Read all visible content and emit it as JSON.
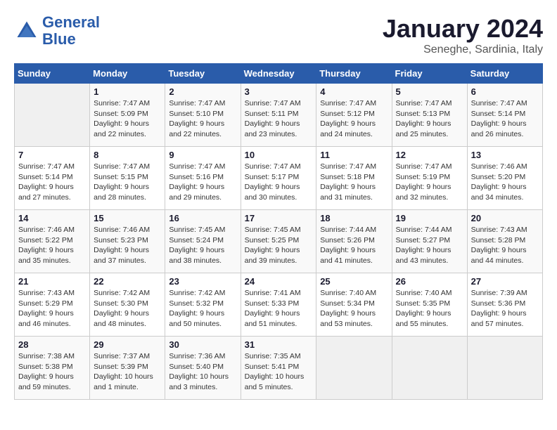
{
  "header": {
    "logo_line1": "General",
    "logo_line2": "Blue",
    "month_year": "January 2024",
    "location": "Seneghe, Sardinia, Italy"
  },
  "weekdays": [
    "Sunday",
    "Monday",
    "Tuesday",
    "Wednesday",
    "Thursday",
    "Friday",
    "Saturday"
  ],
  "weeks": [
    [
      {
        "day": "",
        "sunrise": "",
        "sunset": "",
        "daylight": ""
      },
      {
        "day": "1",
        "sunrise": "Sunrise: 7:47 AM",
        "sunset": "Sunset: 5:09 PM",
        "daylight": "Daylight: 9 hours and 22 minutes."
      },
      {
        "day": "2",
        "sunrise": "Sunrise: 7:47 AM",
        "sunset": "Sunset: 5:10 PM",
        "daylight": "Daylight: 9 hours and 22 minutes."
      },
      {
        "day": "3",
        "sunrise": "Sunrise: 7:47 AM",
        "sunset": "Sunset: 5:11 PM",
        "daylight": "Daylight: 9 hours and 23 minutes."
      },
      {
        "day": "4",
        "sunrise": "Sunrise: 7:47 AM",
        "sunset": "Sunset: 5:12 PM",
        "daylight": "Daylight: 9 hours and 24 minutes."
      },
      {
        "day": "5",
        "sunrise": "Sunrise: 7:47 AM",
        "sunset": "Sunset: 5:13 PM",
        "daylight": "Daylight: 9 hours and 25 minutes."
      },
      {
        "day": "6",
        "sunrise": "Sunrise: 7:47 AM",
        "sunset": "Sunset: 5:14 PM",
        "daylight": "Daylight: 9 hours and 26 minutes."
      }
    ],
    [
      {
        "day": "7",
        "sunrise": "Sunrise: 7:47 AM",
        "sunset": "Sunset: 5:14 PM",
        "daylight": "Daylight: 9 hours and 27 minutes."
      },
      {
        "day": "8",
        "sunrise": "Sunrise: 7:47 AM",
        "sunset": "Sunset: 5:15 PM",
        "daylight": "Daylight: 9 hours and 28 minutes."
      },
      {
        "day": "9",
        "sunrise": "Sunrise: 7:47 AM",
        "sunset": "Sunset: 5:16 PM",
        "daylight": "Daylight: 9 hours and 29 minutes."
      },
      {
        "day": "10",
        "sunrise": "Sunrise: 7:47 AM",
        "sunset": "Sunset: 5:17 PM",
        "daylight": "Daylight: 9 hours and 30 minutes."
      },
      {
        "day": "11",
        "sunrise": "Sunrise: 7:47 AM",
        "sunset": "Sunset: 5:18 PM",
        "daylight": "Daylight: 9 hours and 31 minutes."
      },
      {
        "day": "12",
        "sunrise": "Sunrise: 7:47 AM",
        "sunset": "Sunset: 5:19 PM",
        "daylight": "Daylight: 9 hours and 32 minutes."
      },
      {
        "day": "13",
        "sunrise": "Sunrise: 7:46 AM",
        "sunset": "Sunset: 5:20 PM",
        "daylight": "Daylight: 9 hours and 34 minutes."
      }
    ],
    [
      {
        "day": "14",
        "sunrise": "Sunrise: 7:46 AM",
        "sunset": "Sunset: 5:22 PM",
        "daylight": "Daylight: 9 hours and 35 minutes."
      },
      {
        "day": "15",
        "sunrise": "Sunrise: 7:46 AM",
        "sunset": "Sunset: 5:23 PM",
        "daylight": "Daylight: 9 hours and 37 minutes."
      },
      {
        "day": "16",
        "sunrise": "Sunrise: 7:45 AM",
        "sunset": "Sunset: 5:24 PM",
        "daylight": "Daylight: 9 hours and 38 minutes."
      },
      {
        "day": "17",
        "sunrise": "Sunrise: 7:45 AM",
        "sunset": "Sunset: 5:25 PM",
        "daylight": "Daylight: 9 hours and 39 minutes."
      },
      {
        "day": "18",
        "sunrise": "Sunrise: 7:44 AM",
        "sunset": "Sunset: 5:26 PM",
        "daylight": "Daylight: 9 hours and 41 minutes."
      },
      {
        "day": "19",
        "sunrise": "Sunrise: 7:44 AM",
        "sunset": "Sunset: 5:27 PM",
        "daylight": "Daylight: 9 hours and 43 minutes."
      },
      {
        "day": "20",
        "sunrise": "Sunrise: 7:43 AM",
        "sunset": "Sunset: 5:28 PM",
        "daylight": "Daylight: 9 hours and 44 minutes."
      }
    ],
    [
      {
        "day": "21",
        "sunrise": "Sunrise: 7:43 AM",
        "sunset": "Sunset: 5:29 PM",
        "daylight": "Daylight: 9 hours and 46 minutes."
      },
      {
        "day": "22",
        "sunrise": "Sunrise: 7:42 AM",
        "sunset": "Sunset: 5:30 PM",
        "daylight": "Daylight: 9 hours and 48 minutes."
      },
      {
        "day": "23",
        "sunrise": "Sunrise: 7:42 AM",
        "sunset": "Sunset: 5:32 PM",
        "daylight": "Daylight: 9 hours and 50 minutes."
      },
      {
        "day": "24",
        "sunrise": "Sunrise: 7:41 AM",
        "sunset": "Sunset: 5:33 PM",
        "daylight": "Daylight: 9 hours and 51 minutes."
      },
      {
        "day": "25",
        "sunrise": "Sunrise: 7:40 AM",
        "sunset": "Sunset: 5:34 PM",
        "daylight": "Daylight: 9 hours and 53 minutes."
      },
      {
        "day": "26",
        "sunrise": "Sunrise: 7:40 AM",
        "sunset": "Sunset: 5:35 PM",
        "daylight": "Daylight: 9 hours and 55 minutes."
      },
      {
        "day": "27",
        "sunrise": "Sunrise: 7:39 AM",
        "sunset": "Sunset: 5:36 PM",
        "daylight": "Daylight: 9 hours and 57 minutes."
      }
    ],
    [
      {
        "day": "28",
        "sunrise": "Sunrise: 7:38 AM",
        "sunset": "Sunset: 5:38 PM",
        "daylight": "Daylight: 9 hours and 59 minutes."
      },
      {
        "day": "29",
        "sunrise": "Sunrise: 7:37 AM",
        "sunset": "Sunset: 5:39 PM",
        "daylight": "Daylight: 10 hours and 1 minute."
      },
      {
        "day": "30",
        "sunrise": "Sunrise: 7:36 AM",
        "sunset": "Sunset: 5:40 PM",
        "daylight": "Daylight: 10 hours and 3 minutes."
      },
      {
        "day": "31",
        "sunrise": "Sunrise: 7:35 AM",
        "sunset": "Sunset: 5:41 PM",
        "daylight": "Daylight: 10 hours and 5 minutes."
      },
      {
        "day": "",
        "sunrise": "",
        "sunset": "",
        "daylight": ""
      },
      {
        "day": "",
        "sunrise": "",
        "sunset": "",
        "daylight": ""
      },
      {
        "day": "",
        "sunrise": "",
        "sunset": "",
        "daylight": ""
      }
    ]
  ]
}
